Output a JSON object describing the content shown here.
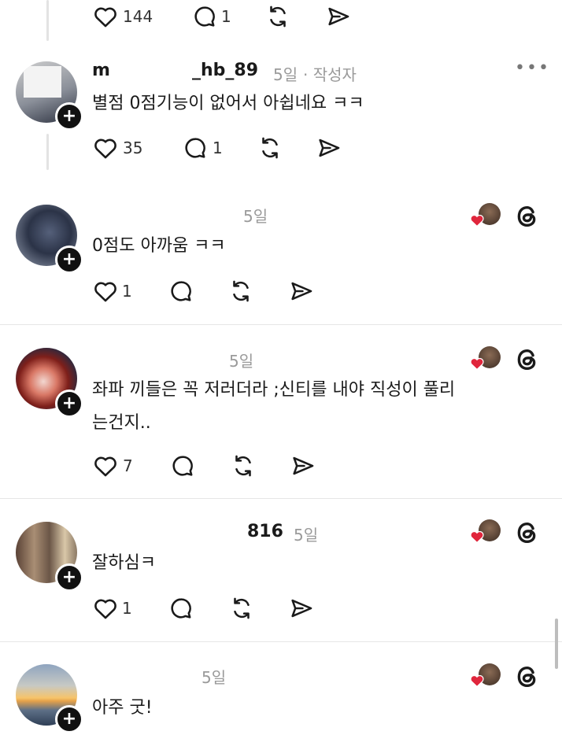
{
  "top_actions": {
    "likes": "144",
    "replies": "1"
  },
  "comments": [
    {
      "username_left": "m",
      "username_right": "_hb_89",
      "time": "5일",
      "author_badge": "· 작성자",
      "text": "별점 0점기능이 없어서 아쉽네요 ㅋㅋ",
      "likes": "35",
      "replies": "1"
    },
    {
      "time": "5일",
      "text": "0점도 아까움 ㅋㅋ",
      "likes": "1"
    },
    {
      "time": "5일",
      "text_line1": "좌파 끼들은 꼭 저러더라 ;신티를 내야 직성이 풀리",
      "text_line2": "는건지..",
      "likes": "7"
    },
    {
      "username": "816",
      "time": "5일",
      "text": "잘하심ㅋ",
      "likes": "1"
    },
    {
      "time": "5일",
      "text": "아주 굿!"
    }
  ],
  "colors": {
    "heart": "#e0263c",
    "icon": "#1a1a1a",
    "meta": "#9a9a9a"
  }
}
